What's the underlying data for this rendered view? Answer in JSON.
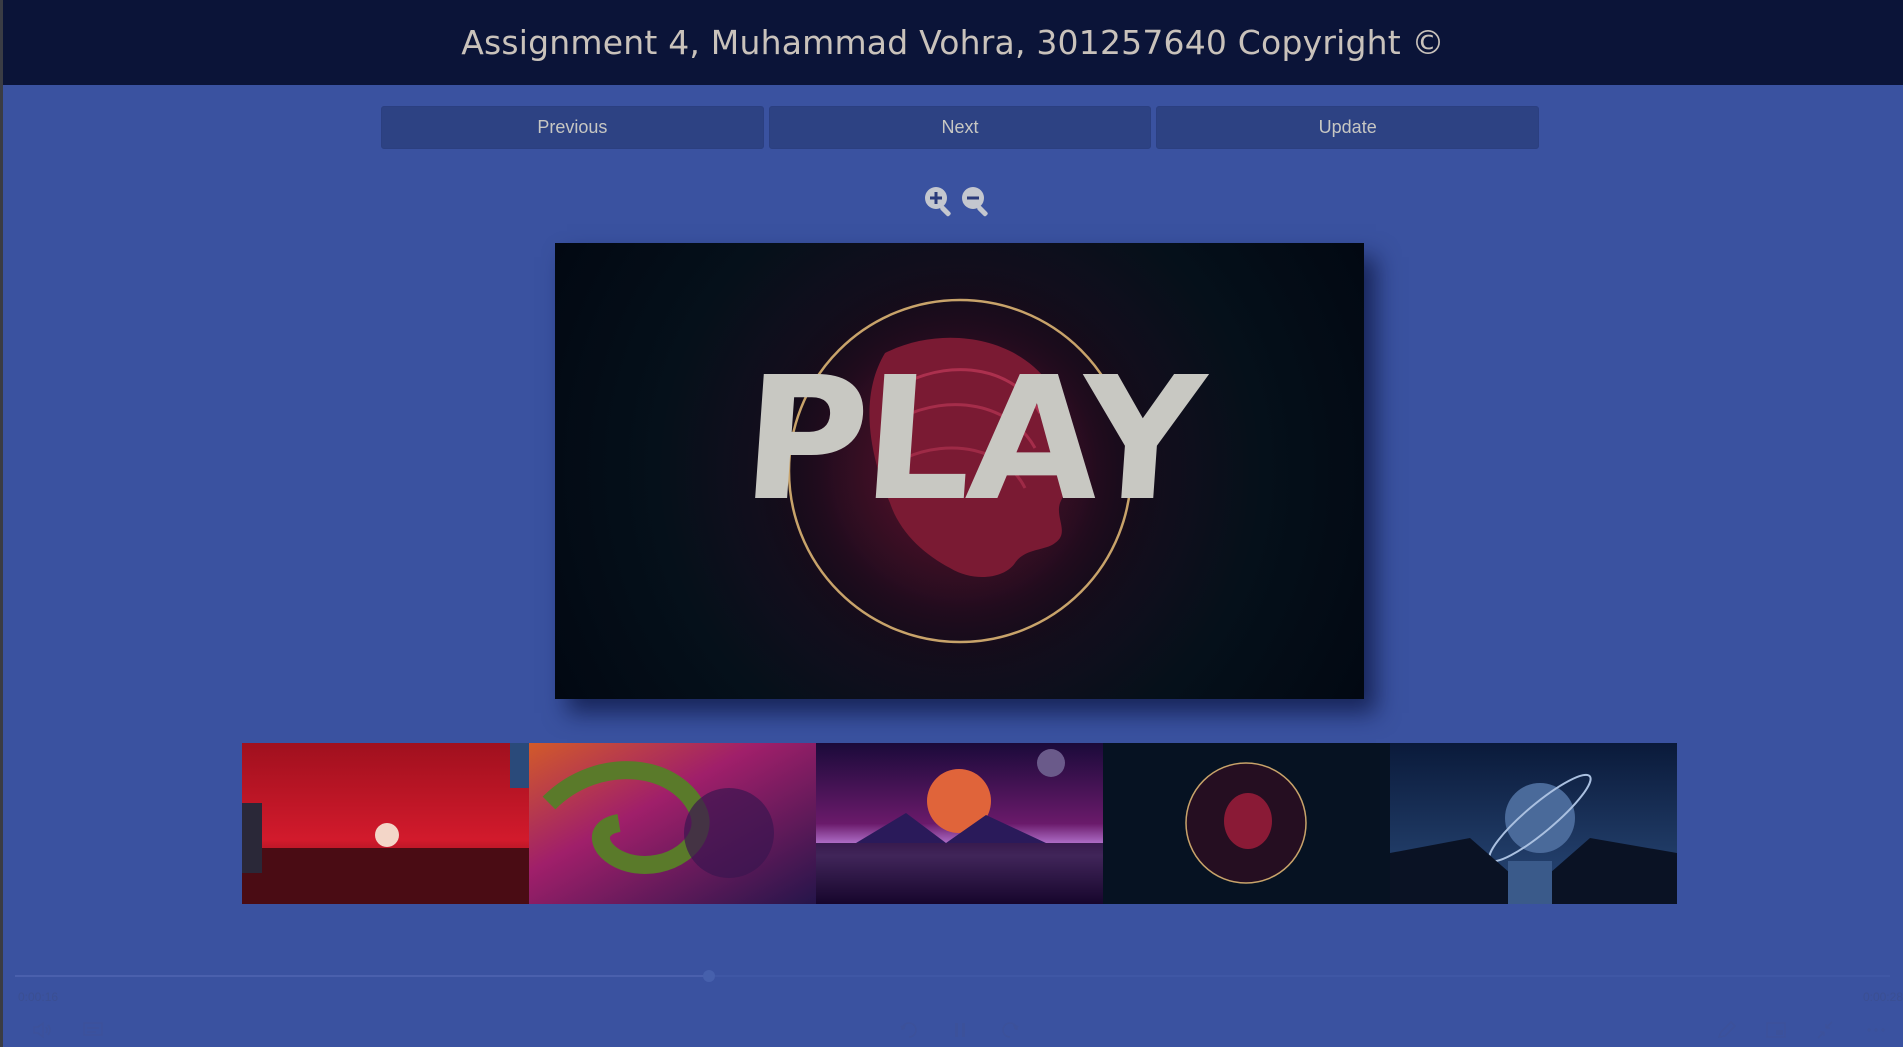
{
  "header": {
    "title": "Assignment 4, Muhammad Vohra, 301257640 Copyright ©"
  },
  "toolbar": {
    "previous_label": "Previous",
    "next_label": "Next",
    "update_label": "Update"
  },
  "viewer": {
    "overlay_text": "PLAY"
  },
  "thumbnails": [
    {
      "name": "red-city-sunset"
    },
    {
      "name": "dragon-nebula"
    },
    {
      "name": "synthwave-sunset"
    },
    {
      "name": "skull-circle"
    },
    {
      "name": "planet-staircase"
    }
  ],
  "player": {
    "elapsed": "0:00:16",
    "total": "0:00:28",
    "progress": 0.37
  },
  "colors": {
    "background": "#3a52a0",
    "header": "#0b1438",
    "button": "#2d4283"
  }
}
